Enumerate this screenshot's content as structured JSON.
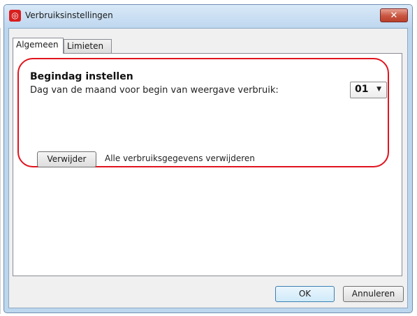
{
  "window": {
    "title": "Verbruiksinstellingen",
    "close_glyph": "✕"
  },
  "tabs": [
    {
      "label": "Algemeen",
      "active": true
    },
    {
      "label": "Limieten",
      "active": false
    }
  ],
  "general": {
    "section_title": "Begindag instellen",
    "start_day_desc": "Dag van de maand voor begin van weergave verbruik:",
    "start_day_value": "01",
    "delete_button": "Verwijder",
    "delete_desc": "Alle verbruiksgegevens verwijderen"
  },
  "footer": {
    "ok_label": "OK",
    "cancel_label": "Annuleren"
  },
  "icons": {
    "app": "vodafone-icon",
    "close": "close-icon",
    "dropdown": "chevron-down-icon"
  },
  "colors": {
    "titlebar": "#bfd7ef",
    "close_button": "#c8543f",
    "highlight": "#e0141e",
    "app_icon": "#d81e1e"
  }
}
